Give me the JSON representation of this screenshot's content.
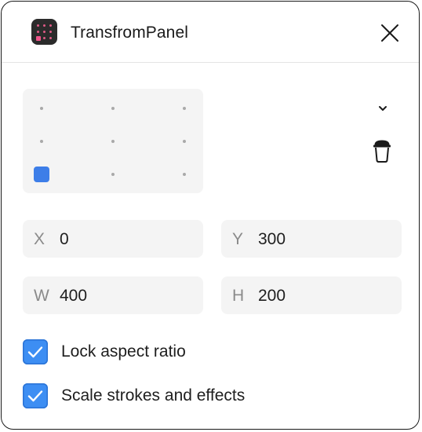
{
  "header": {
    "title": "TransfromPanel",
    "app_icon": "app-grid-icon",
    "close_icon": "close-icon"
  },
  "origin": {
    "grid_rows": 3,
    "grid_cols": 3,
    "selected": "bottom-left",
    "selected_color": "#3d7ee8"
  },
  "toolbar": {
    "chevron_icon": "chevron-down-icon",
    "trash_icon": "trash-icon"
  },
  "fields": {
    "x": {
      "label": "X",
      "value": "0"
    },
    "y": {
      "label": "Y",
      "value": "300"
    },
    "w": {
      "label": "W",
      "value": "400"
    },
    "h": {
      "label": "H",
      "value": "200"
    }
  },
  "options": {
    "lock_aspect": {
      "label": "Lock aspect ratio",
      "checked": true
    },
    "scale_strokes": {
      "label": "Scale strokes and effects",
      "checked": true
    }
  },
  "colors": {
    "accent": "#3d8ef3",
    "field_bg": "#f4f4f4",
    "border": "#1a1a1a"
  }
}
